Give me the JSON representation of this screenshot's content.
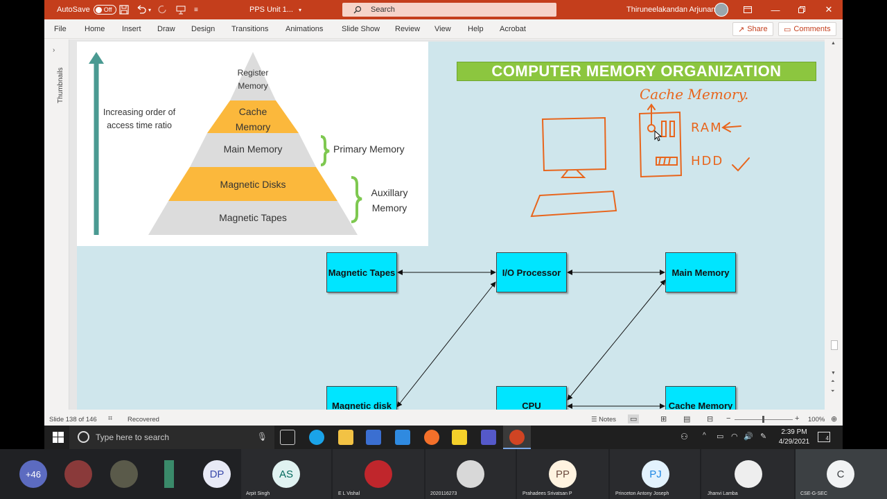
{
  "titlebar": {
    "autosave_label": "AutoSave",
    "autosave_state": "Off",
    "file_title": "PPS Unit 1...",
    "search_placeholder": "Search",
    "user_name": "Thiruneelakandan Arjunan"
  },
  "ribbon": {
    "tabs": [
      "File",
      "Home",
      "Insert",
      "Draw",
      "Design",
      "Transitions",
      "Animations",
      "Slide Show",
      "Review",
      "View",
      "Help",
      "Acrobat"
    ],
    "share_label": "Share",
    "comments_label": "Comments"
  },
  "thumbnails_label": "Thumbnails",
  "slide": {
    "title": "COMPUTER MEMORY ORGANIZATION",
    "pyramid": {
      "levels": [
        "Register Memory",
        "Cache Memory",
        "Main Memory",
        "Magnetic Disks",
        "Magnetic Tapes"
      ],
      "arrow_caption_line1": "Increasing order of",
      "arrow_caption_line2": "access time ratio",
      "primary_label": "Primary Memory",
      "aux_label_line1": "Auxillary",
      "aux_label_line2": "Memory"
    },
    "handwriting": {
      "cache": "Cache Memory.",
      "ram": "RAM",
      "hdd": "HDD"
    },
    "diagram": {
      "boxes": [
        "Magnetic Tapes",
        "I/O Processor",
        "Main Memory",
        "Magnetic disk",
        "CPU",
        "Cache Memory"
      ]
    },
    "colors": {
      "title_bg": "#8cc63f",
      "pyramid_orange": "#fbb83c",
      "pyramid_gray": "#dcdcdc",
      "arrow_teal": "#4a9a92",
      "ink_orange": "#e8651c",
      "box_cyan": "#00e5ff"
    }
  },
  "status": {
    "slide_info": "Slide 138 of 146",
    "recovered": "Recovered",
    "notes": "Notes",
    "zoom": "100%"
  },
  "taskbar": {
    "search_placeholder": "Type here to search",
    "time": "2:39 PM",
    "date": "4/29/2021",
    "notifications": "4"
  },
  "meet": {
    "more_count": "+46",
    "participants": [
      {
        "initials": "",
        "name": ""
      },
      {
        "initials": "",
        "name": ""
      },
      {
        "initials": "",
        "name": ""
      },
      {
        "initials": "DP",
        "name": ""
      },
      {
        "initials": "AS",
        "name": "Arpit Singh"
      },
      {
        "initials": "",
        "name": "E L Vishal"
      },
      {
        "initials": "",
        "name": "2020116273"
      },
      {
        "initials": "PP",
        "name": "Prahadees Srivatsan P"
      },
      {
        "initials": "PJ",
        "name": "Princeton Antony Joseph"
      },
      {
        "initials": "",
        "name": "Jhanvi Lamba"
      },
      {
        "initials": "C",
        "name": "CSE-G-SEC"
      }
    ]
  }
}
